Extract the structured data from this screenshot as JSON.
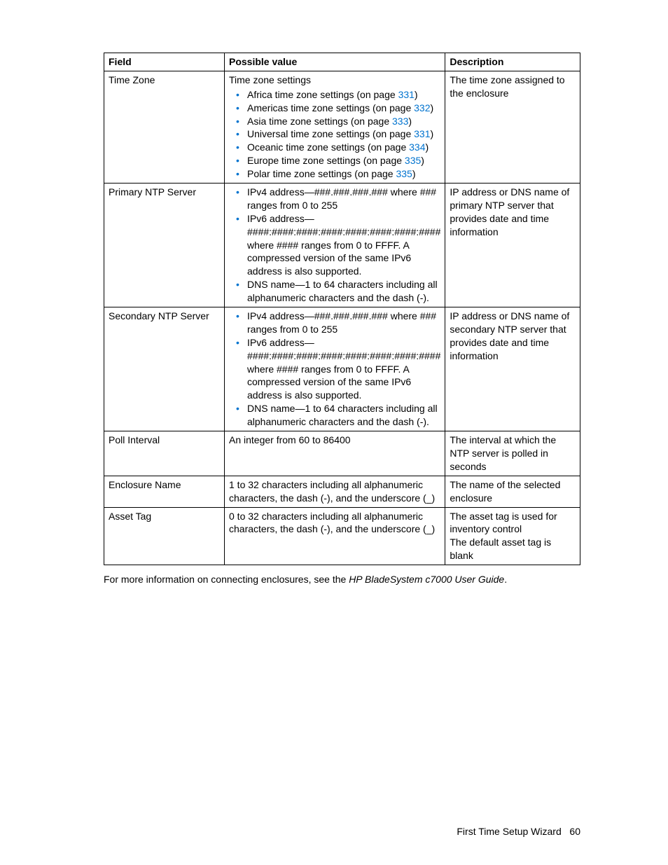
{
  "header": {
    "col1": "Field",
    "col2": "Possible value",
    "col3": "Description"
  },
  "rows": {
    "tz": {
      "field": "Time Zone",
      "heading": "Time zone settings",
      "items": [
        {
          "prefix": "Africa time zone settings (on page ",
          "link": "331",
          "suffix": ")"
        },
        {
          "prefix": "Americas time zone settings (on page ",
          "link": "332",
          "suffix": ")"
        },
        {
          "prefix": "Asia time zone settings (on page ",
          "link": "333",
          "suffix": ")"
        },
        {
          "prefix": "Universal time zone settings (on page ",
          "link": "331",
          "suffix": ")"
        },
        {
          "prefix": "Oceanic time zone settings (on page ",
          "link": "334",
          "suffix": ")"
        },
        {
          "prefix": "Europe time zone settings (on page ",
          "link": "335",
          "suffix": ")"
        },
        {
          "prefix": "Polar time zone settings (on page ",
          "link": "335",
          "suffix": ")"
        }
      ],
      "desc": "The time zone assigned to the enclosure"
    },
    "pntp": {
      "field": "Primary NTP Server",
      "items": [
        "IPv4 address—###.###.###.### where ### ranges from 0 to 255",
        "IPv6 address—####:####:####:####:####:####:####:#### where #### ranges from 0 to FFFF. A compressed version of the same IPv6 address is also supported.",
        "DNS name—1 to 64 characters including all alphanumeric characters and the dash (-)."
      ],
      "desc": "IP address or DNS name of primary NTP server that provides date and time information"
    },
    "sntp": {
      "field": "Secondary NTP Server",
      "items": [
        "IPv4 address—###.###.###.### where ### ranges from 0 to 255",
        "IPv6 address—####:####:####:####:####:####:####:#### where #### ranges from 0 to FFFF. A compressed version of the same IPv6 address is also supported.",
        "DNS name—1 to 64 characters including all alphanumeric characters and the dash (-)."
      ],
      "desc": "IP address or DNS name of secondary NTP server that provides date and time information"
    },
    "poll": {
      "field": "Poll Interval",
      "value": "An integer from 60 to 86400",
      "desc": "The interval at which the NTP server is polled in seconds"
    },
    "enc": {
      "field": "Enclosure Name",
      "value": "1 to 32 characters including all alphanumeric characters, the dash (-), and the underscore (_)",
      "desc": "The name of the selected enclosure"
    },
    "asset": {
      "field": "Asset Tag",
      "value": "0 to 32 characters including all alphanumeric characters, the dash (-), and the underscore (_)",
      "desc1": "The asset tag is used for inventory control",
      "desc2": "The default asset tag is blank"
    }
  },
  "after": {
    "text": "For more information on connecting enclosures, see the ",
    "italic": "HP BladeSystem c7000 User Guide",
    "period": "."
  },
  "footer": {
    "label": "First Time Setup Wizard",
    "page": "60"
  }
}
